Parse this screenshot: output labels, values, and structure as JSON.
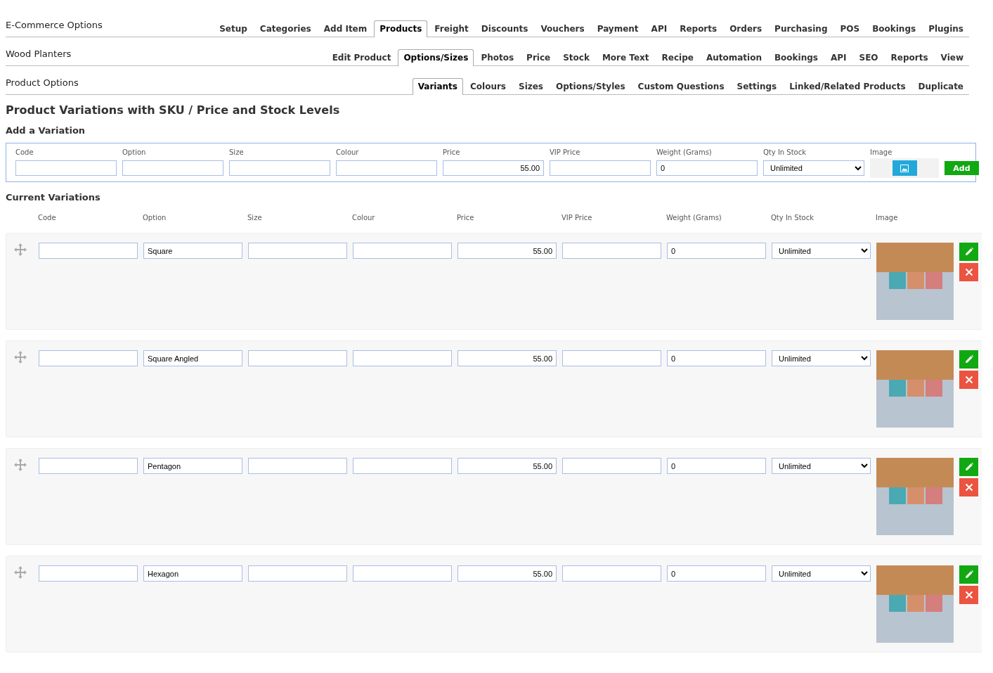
{
  "nav_rows": [
    {
      "label": "E-Commerce Options",
      "tabs": [
        {
          "label": "Setup",
          "selected": false
        },
        {
          "label": "Categories",
          "selected": false
        },
        {
          "label": "Add Item",
          "selected": false
        },
        {
          "label": "Products",
          "selected": true
        },
        {
          "label": "Freight",
          "selected": false
        },
        {
          "label": "Discounts",
          "selected": false
        },
        {
          "label": "Vouchers",
          "selected": false
        },
        {
          "label": "Payment",
          "selected": false
        },
        {
          "label": "API",
          "selected": false
        },
        {
          "label": "Reports",
          "selected": false
        },
        {
          "label": "Orders",
          "selected": false
        },
        {
          "label": "Purchasing",
          "selected": false
        },
        {
          "label": "POS",
          "selected": false
        },
        {
          "label": "Bookings",
          "selected": false
        },
        {
          "label": "Plugins",
          "selected": false
        }
      ]
    },
    {
      "label": "Wood Planters",
      "tabs": [
        {
          "label": "Edit Product",
          "selected": false
        },
        {
          "label": "Options/Sizes",
          "selected": true
        },
        {
          "label": "Photos",
          "selected": false
        },
        {
          "label": "Price",
          "selected": false
        },
        {
          "label": "Stock",
          "selected": false
        },
        {
          "label": "More Text",
          "selected": false
        },
        {
          "label": "Recipe",
          "selected": false
        },
        {
          "label": "Automation",
          "selected": false
        },
        {
          "label": "Bookings",
          "selected": false
        },
        {
          "label": "API",
          "selected": false
        },
        {
          "label": "SEO",
          "selected": false
        },
        {
          "label": "Reports",
          "selected": false
        },
        {
          "label": "View",
          "selected": false
        }
      ]
    },
    {
      "label": "Product Options",
      "tabs": [
        {
          "label": "Variants",
          "selected": true
        },
        {
          "label": "Colours",
          "selected": false
        },
        {
          "label": "Sizes",
          "selected": false
        },
        {
          "label": "Options/Styles",
          "selected": false
        },
        {
          "label": "Custom Questions",
          "selected": false
        },
        {
          "label": "Settings",
          "selected": false
        },
        {
          "label": "Linked/Related Products",
          "selected": false
        },
        {
          "label": "Duplicate",
          "selected": false
        }
      ]
    }
  ],
  "page_title": "Product Variations with SKU / Price and Stock Levels",
  "add_form": {
    "title": "Add a Variation",
    "columns": [
      "Code",
      "Option",
      "Size",
      "Colour",
      "Price",
      "VIP Price",
      "Weight (Grams)",
      "Qty In Stock",
      "Image"
    ],
    "price": "55.00",
    "weight": "0",
    "qty_in_stock": "Unlimited",
    "add_button": "Add"
  },
  "current": {
    "title": "Current Variations",
    "columns": [
      "Code",
      "Option",
      "Size",
      "Colour",
      "Price",
      "VIP Price",
      "Weight (Grams)",
      "Qty In Stock",
      "Image"
    ],
    "rows": [
      {
        "option": "Square",
        "price": "55.00",
        "weight": "0",
        "qty_in_stock": "Unlimited"
      },
      {
        "option": "Square Angled",
        "price": "55.00",
        "weight": "0",
        "qty_in_stock": "Unlimited"
      },
      {
        "option": "Pentagon",
        "price": "55.00",
        "weight": "0",
        "qty_in_stock": "Unlimited"
      },
      {
        "option": "Hexagon",
        "price": "55.00",
        "weight": "0",
        "qty_in_stock": "Unlimited"
      }
    ]
  }
}
